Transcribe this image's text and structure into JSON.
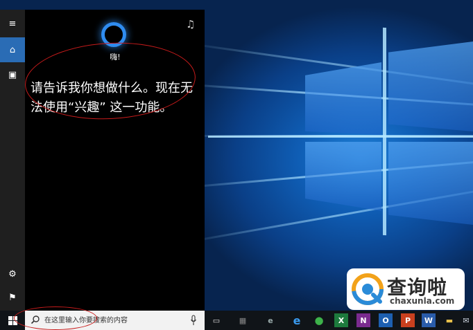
{
  "cortana": {
    "greeting": "嗨!",
    "message": "请告诉我你想做什么。现在无法使用“兴趣” 这一功能。"
  },
  "rail": {
    "items": [
      {
        "icon": "hamburger-menu-icon",
        "glyph": "≡"
      },
      {
        "icon": "home-icon",
        "glyph": "⌂"
      },
      {
        "icon": "notebook-icon",
        "glyph": "▣"
      },
      {
        "icon": "settings-icon",
        "glyph": "⚙"
      },
      {
        "icon": "feedback-icon",
        "glyph": "⚑"
      }
    ]
  },
  "taskbar": {
    "search_placeholder": "在这里输入你要搜索的内容",
    "apps": [
      {
        "name": "task-view-icon",
        "glyph": "▭"
      },
      {
        "name": "store-icon",
        "glyph": "▦"
      },
      {
        "name": "ie-icon",
        "glyph": "e"
      },
      {
        "name": "edge-icon",
        "glyph": "e"
      },
      {
        "name": "green-app-icon",
        "glyph": "●"
      },
      {
        "name": "excel-icon",
        "glyph": "X"
      },
      {
        "name": "onenote-icon",
        "glyph": "N"
      },
      {
        "name": "outlook-icon",
        "glyph": "O"
      },
      {
        "name": "powerpoint-icon",
        "glyph": "P"
      },
      {
        "name": "word-icon",
        "glyph": "W"
      },
      {
        "name": "explorer-icon",
        "glyph": "▬"
      },
      {
        "name": "mail-icon",
        "glyph": "✉"
      }
    ]
  },
  "watermark": {
    "title": "查询啦",
    "url": "chaxunla.com"
  },
  "colors": {
    "accent": "#2a6cb5",
    "cortana_ring": "#2f8cf0",
    "annotation": "#c81b1b"
  }
}
